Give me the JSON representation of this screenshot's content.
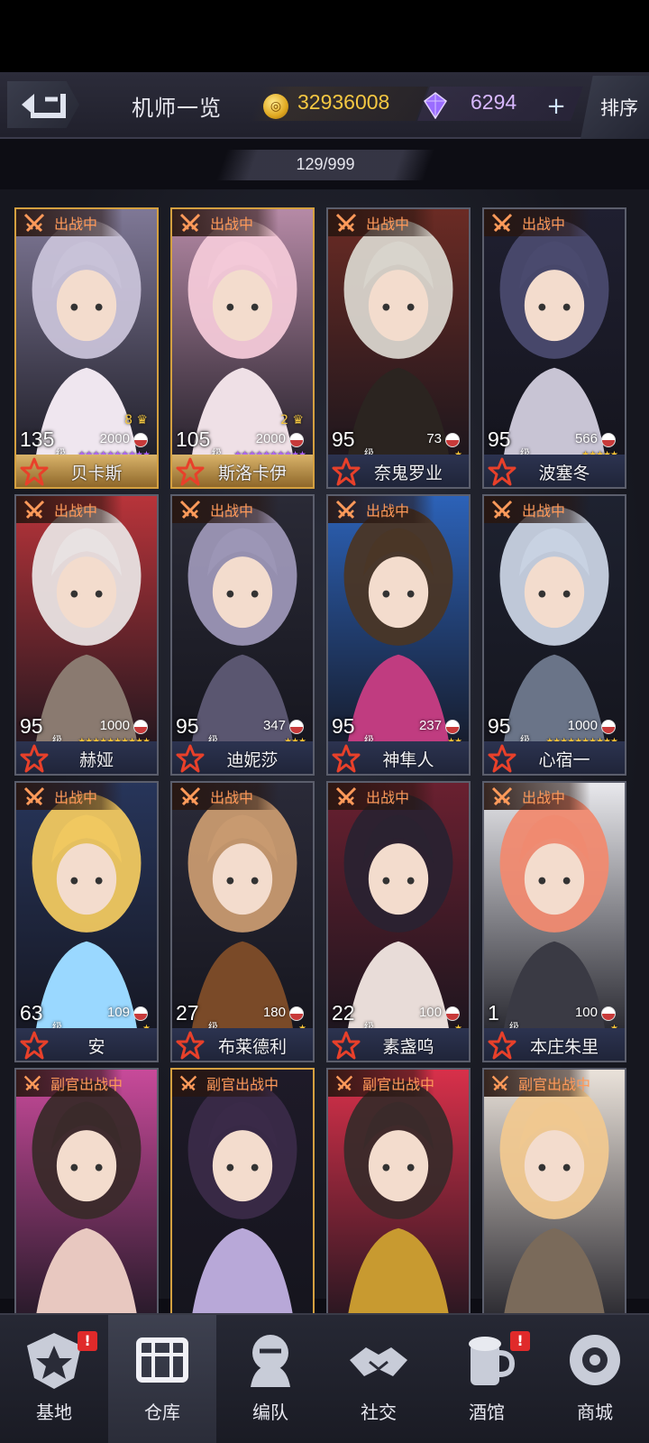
{
  "header": {
    "title": "机师一览",
    "gold": "32936008",
    "gems": "6294",
    "plus": "+",
    "sort": "排序",
    "count": "129/999"
  },
  "level_unit": "级",
  "pilots": [
    {
      "status": "出战中",
      "level": "135",
      "exp": "2000",
      "crowns": "8",
      "stars": "★★★★★★★★★★",
      "star_color": "#b266ff",
      "name": "贝卡斯",
      "rarity": "gold"
    },
    {
      "status": "出战中",
      "level": "105",
      "exp": "2000",
      "crowns": "2",
      "stars": "★★★★★★★★★★",
      "star_color": "#b266ff",
      "name": "斯洛卡伊",
      "rarity": "gold"
    },
    {
      "status": "出战中",
      "level": "95",
      "exp": "73",
      "crowns": "",
      "stars": "★",
      "star_color": "#ffc93a",
      "name": "奈鬼罗业",
      "rarity": "normal"
    },
    {
      "status": "出战中",
      "level": "95",
      "exp": "566",
      "crowns": "",
      "stars": "★★★★★",
      "star_color": "#ffc93a",
      "name": "波塞冬",
      "rarity": "normal"
    },
    {
      "status": "出战中",
      "level": "95",
      "exp": "1000",
      "crowns": "",
      "stars": "★★★★★★★★★★",
      "star_color": "#ffc93a",
      "name": "赫娅",
      "rarity": "normal"
    },
    {
      "status": "出战中",
      "level": "95",
      "exp": "347",
      "crowns": "",
      "stars": "★★★",
      "star_color": "#ffc93a",
      "name": "迪妮莎",
      "rarity": "normal"
    },
    {
      "status": "出战中",
      "level": "95",
      "exp": "237",
      "crowns": "",
      "stars": "★★",
      "star_color": "#ffc93a",
      "name": "神隼人",
      "rarity": "normal"
    },
    {
      "status": "出战中",
      "level": "95",
      "exp": "1000",
      "crowns": "",
      "stars": "★★★★★★★★★★",
      "star_color": "#ffc93a",
      "name": "心宿一",
      "rarity": "normal"
    },
    {
      "status": "出战中",
      "level": "63",
      "exp": "109",
      "crowns": "",
      "stars": "★",
      "star_color": "#ffc93a",
      "name": "安",
      "rarity": "normal"
    },
    {
      "status": "出战中",
      "level": "27",
      "exp": "180",
      "crowns": "",
      "stars": "★",
      "star_color": "#ffc93a",
      "name": "布莱德利",
      "rarity": "normal"
    },
    {
      "status": "出战中",
      "level": "22",
      "exp": "100",
      "crowns": "",
      "stars": "★",
      "star_color": "#ffc93a",
      "name": "素盏呜",
      "rarity": "normal"
    },
    {
      "status": "出战中",
      "level": "1",
      "exp": "100",
      "crowns": "",
      "stars": "★",
      "star_color": "#ffc93a",
      "name": "本庄朱里",
      "rarity": "normal"
    },
    {
      "status": "副官出战中",
      "rarity": "normal"
    },
    {
      "status": "副官出战中",
      "rarity": "gold"
    },
    {
      "status": "副官出战中",
      "rarity": "normal"
    },
    {
      "status": "副官出战中",
      "rarity": "normal"
    }
  ],
  "nav": [
    {
      "label": "基地",
      "icon": "base-icon",
      "badge": "!"
    },
    {
      "label": "仓库",
      "icon": "warehouse-icon",
      "active": true
    },
    {
      "label": "编队",
      "icon": "formation-icon"
    },
    {
      "label": "社交",
      "icon": "social-icon"
    },
    {
      "label": "酒馆",
      "icon": "tavern-icon",
      "badge": "!"
    },
    {
      "label": "商城",
      "icon": "shop-icon"
    }
  ],
  "palette": {
    "portraits": [
      [
        "#c8c2d8",
        "#7f7896",
        "#efe6ef"
      ],
      [
        "#f3c9d8",
        "#b68aa6",
        "#efe0e6"
      ],
      [
        "#d8d4cc",
        "#6b2b24",
        "#2b2420"
      ],
      [
        "#4a4a6e",
        "#1f1f30",
        "#c8c4d4"
      ],
      [
        "#e8e2e2",
        "#b8343a",
        "#8a7a70"
      ],
      [
        "#9c96b6",
        "#2a2a36",
        "#5a5670"
      ],
      [
        "#4a3626",
        "#2c62b8",
        "#c03c80"
      ],
      [
        "#c8d2e2",
        "#1e2230",
        "#6a7488"
      ],
      [
        "#f0c860",
        "#27355a",
        "#9ad8ff"
      ],
      [
        "#c89a70",
        "#2a2a38",
        "#7a4a28"
      ],
      [
        "#2a2230",
        "#6a2030",
        "#e8dcd8"
      ],
      [
        "#f08a70",
        "#e8e8ec",
        "#3a3a44"
      ],
      [
        "#3a2a2a",
        "#c84a9a",
        "#e8c8c0"
      ],
      [
        "#3a2a48",
        "#1e1a28",
        "#b8a8d8"
      ],
      [
        "#3a2a2a",
        "#d8304a",
        "#c89a30"
      ],
      [
        "#f0c890",
        "#eae2da",
        "#7a6a5a"
      ]
    ]
  }
}
